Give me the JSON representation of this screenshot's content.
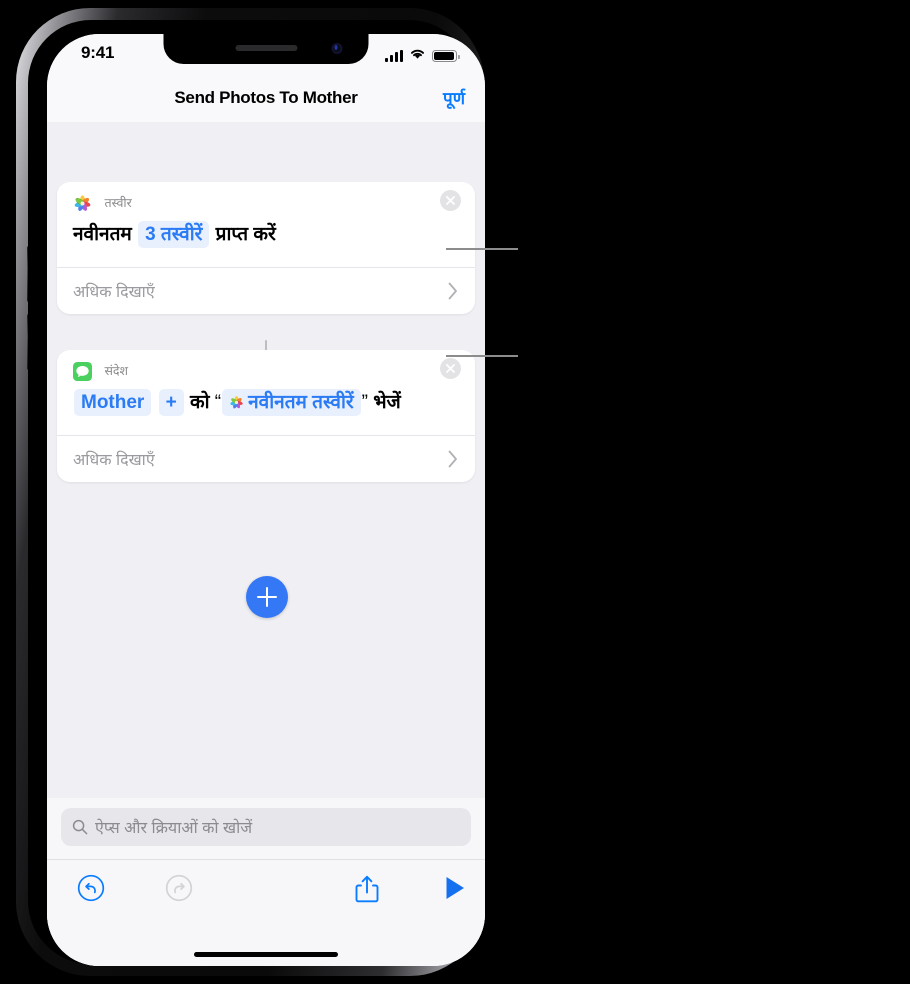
{
  "status_bar": {
    "time": "9:41",
    "cellular_icon": "cellular-signal-icon",
    "wifi_icon": "wifi-icon",
    "battery_icon": "battery-icon"
  },
  "nav": {
    "title": "Send Photos To Mother",
    "done_label": "पूर्ण"
  },
  "cards": [
    {
      "app_icon": "photos-app-icon",
      "app_name": "तस्वीर",
      "close_icon": "close-circle-icon",
      "text_parts": [
        {
          "type": "text",
          "value": "नवीनतम"
        },
        {
          "type": "token",
          "value": "3 तस्वीरें"
        },
        {
          "type": "text",
          "value": "प्राप्त करें"
        }
      ],
      "show_more_label": "अधिक दिखाएँ",
      "chevron_icon": "chevron-right-icon"
    },
    {
      "app_icon": "messages-app-icon",
      "app_name": "संदेश",
      "close_icon": "close-circle-icon",
      "text_parts": [
        {
          "type": "token",
          "value": "Mother"
        },
        {
          "type": "token",
          "value": "+"
        },
        {
          "type": "text",
          "value": "को"
        },
        {
          "type": "quote",
          "value": "“"
        },
        {
          "type": "token-photo",
          "value": "नवीनतम तस्वीरें"
        },
        {
          "type": "quote",
          "value": "”"
        },
        {
          "type": "text",
          "value": "भेजें"
        }
      ],
      "show_more_label": "अधिक दिखाएँ",
      "chevron_icon": "chevron-right-icon"
    }
  ],
  "add_button": {
    "icon": "plus-icon",
    "label": "+"
  },
  "search": {
    "icon": "search-icon",
    "placeholder": "ऐप्स और क्रियाओं को खोजें"
  },
  "toolbar": {
    "undo_icon": "undo-icon",
    "redo_icon": "redo-icon",
    "share_icon": "share-icon",
    "run_icon": "play-icon"
  },
  "colors": {
    "accent_blue": "#0a7cff",
    "token_blue": "#2a7bf4",
    "token_bg": "#e9f0fd",
    "add_button_blue": "#3478f6",
    "messages_green": "#4cd964",
    "disabled_gray": "#c7c7cc",
    "screen_bg": "#f0f0f4",
    "card_bg": "#ffffff"
  },
  "callouts": [
    {
      "name": "callout-line-photos-action"
    },
    {
      "name": "callout-line-message-action"
    }
  ]
}
